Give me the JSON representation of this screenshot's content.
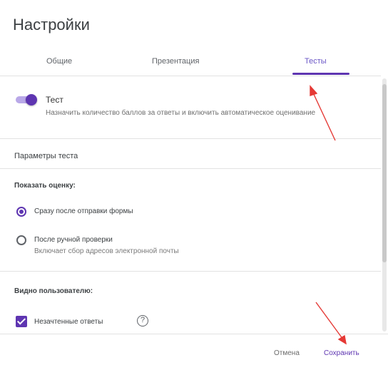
{
  "dialog": {
    "title": "Настройки"
  },
  "tabs": [
    {
      "label": "Общие"
    },
    {
      "label": "Презентация"
    },
    {
      "label": "Тесты"
    }
  ],
  "quiz": {
    "toggle_on": true,
    "label": "Тест",
    "description": "Назначить количество баллов за ответы и включить автоматическое оценивание"
  },
  "params": {
    "title": "Параметры теста",
    "show_score_label": "Показать оценку:",
    "options": [
      {
        "label": "Сразу после отправки формы",
        "selected": true
      },
      {
        "label": "После ручной проверки",
        "desc": "Включает сбор адресов электронной почты",
        "selected": false
      }
    ],
    "visible_label": "Видно пользователю:",
    "checkbox_label": "Незачтенные ответы"
  },
  "footer": {
    "cancel": "Отмена",
    "save": "Сохранить"
  },
  "colors": {
    "accent": "#5e35b1",
    "arrow": "#e53935"
  }
}
